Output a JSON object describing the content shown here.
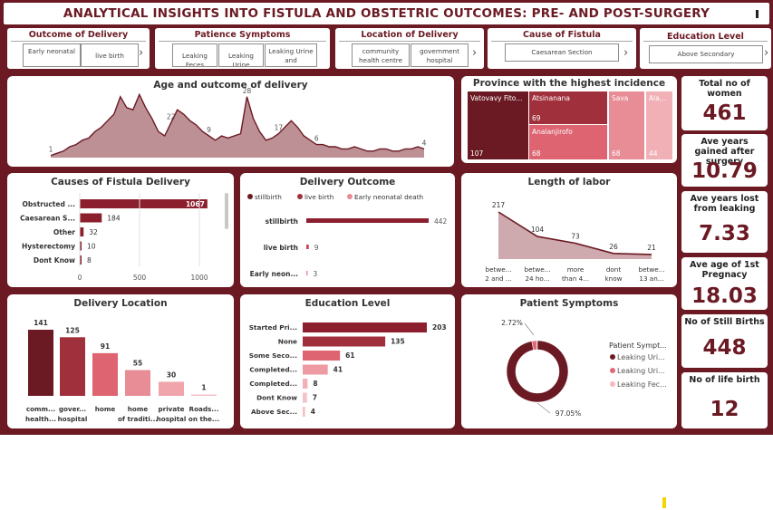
{
  "title": "ANALYTICAL INSIGHTS INTO FISTULA AND OBSTETRIC OUTCOMES: PRE- AND POST-SURGERY",
  "slicers": [
    {
      "header": "Outcome of Delivery",
      "options": [
        "Early neonatal",
        "live birth"
      ]
    },
    {
      "header": "Patience Symptoms",
      "options": [
        "Leaking Feces",
        "Leaking Urine",
        "Leaking Urine and"
      ]
    },
    {
      "header": "Location of Delivery",
      "options": [
        "community health centre",
        "government hospital"
      ]
    },
    {
      "header": "Cause of Fistula",
      "options": [
        "Caesarean Section"
      ]
    },
    {
      "header": "Education Level",
      "options": [
        "Above Secondary"
      ]
    }
  ],
  "kpis": [
    {
      "label": "Total no of women",
      "value": "461"
    },
    {
      "label": "Ave years gained after surgery",
      "value": "10.79"
    },
    {
      "label": "Ave years lost from leaking",
      "value": "7.33"
    },
    {
      "label": "Ave age of 1st Pregnacy",
      "value": "18.03"
    },
    {
      "label": "No of Still Births",
      "value": "448"
    },
    {
      "label": "No of life birth",
      "value": "12"
    }
  ],
  "chart_data": [
    {
      "id": "age",
      "type": "area",
      "title": "Age and outcome of delivery",
      "values": [
        1,
        2,
        3,
        5,
        6,
        8,
        9,
        12,
        14,
        17,
        20,
        28,
        23,
        22,
        29,
        23,
        18,
        12,
        10,
        16,
        22,
        20,
        17,
        15,
        12,
        10,
        8,
        10,
        9,
        10,
        11,
        28,
        18,
        12,
        8,
        9,
        11,
        14,
        17,
        14,
        10,
        8,
        6,
        6,
        5,
        5,
        4,
        4,
        5,
        4,
        3,
        3,
        4,
        4,
        3,
        3,
        4,
        4,
        5,
        4
      ],
      "labels": [
        {
          "i": 0,
          "text": "1"
        },
        {
          "i": 19,
          "text": "22"
        },
        {
          "i": 25,
          "text": "9"
        },
        {
          "i": 31,
          "text": "28"
        },
        {
          "i": 36,
          "text": "17"
        },
        {
          "i": 42,
          "text": "6"
        },
        {
          "i": 59,
          "text": "4"
        }
      ],
      "color": "#b27d84"
    },
    {
      "id": "province",
      "type": "treemap",
      "title": "Province with the highest incidence",
      "items": [
        {
          "name": "Vatovavy Fito...",
          "value": 107,
          "color": "#6b1a23"
        },
        {
          "name": "Atsinanana",
          "value": 69,
          "color": "#a0303c"
        },
        {
          "name": "Analanjirofo",
          "value": 68,
          "color": "#dd6470"
        },
        {
          "name": "Sava",
          "value": 68,
          "color": "#e88c96"
        },
        {
          "name": "Ala...",
          "value": 44,
          "color": "#f0b0b6"
        }
      ]
    },
    {
      "id": "causes",
      "type": "bar",
      "orientation": "horizontal",
      "title": "Causes of Fistula Delivery",
      "categories": [
        "Obstructed ...",
        "Caesarean S...",
        "Other",
        "Hysterectomy",
        "Dont Know"
      ],
      "values": [
        1067,
        184,
        32,
        10,
        8
      ],
      "xlim": [
        0,
        1000
      ],
      "ticks": [
        "0",
        "500",
        "1000"
      ],
      "color": "#8b1f2d"
    },
    {
      "id": "outcome",
      "type": "bar",
      "orientation": "horizontal",
      "title": "Delivery Outcome",
      "legend": [
        "stillbirth",
        "live birth",
        "Early neonatal death"
      ],
      "legend_colors": [
        "#6b1a23",
        "#a0303c",
        "#e88c96"
      ],
      "categories": [
        "stillbirth",
        "live birth",
        "Early neon..."
      ],
      "values": [
        442,
        9,
        3
      ],
      "colors": [
        "#8b1f2d",
        "#c54553",
        "#e88c96"
      ]
    },
    {
      "id": "labor",
      "type": "area",
      "title": "Length of labor",
      "categories": [
        "betwe... 2 and ...",
        "betwe... 24 ho...",
        "more than 4...",
        "dont know",
        "betwe... 13 an..."
      ],
      "values": [
        217,
        104,
        73,
        26,
        21
      ],
      "color": "#c9a0a5"
    },
    {
      "id": "location",
      "type": "bar",
      "title": "Delivery Location",
      "categories": [
        "comm... health...",
        "gover... hospital",
        "home",
        "home of traditi...",
        "private hospital",
        "Roads... on the..."
      ],
      "values": [
        141,
        125,
        91,
        55,
        30,
        1
      ],
      "colors": [
        "#6b1a23",
        "#a0303c",
        "#dd6470",
        "#e88c96",
        "#f0a4ac",
        "#f4c2c7"
      ]
    },
    {
      "id": "education",
      "type": "bar",
      "orientation": "horizontal",
      "title": "Education Level",
      "categories": [
        "Started Pri...",
        "None",
        "Some Seco...",
        "Completed...",
        "Completed...",
        "Dont Know",
        "Above Sec..."
      ],
      "values": [
        203,
        135,
        61,
        41,
        8,
        7,
        4
      ],
      "colors": [
        "#8b1f2d",
        "#a0303c",
        "#dd6470",
        "#ee9aa2",
        "#f2b0b6",
        "#f4c2c7",
        "#f4c2c7"
      ]
    },
    {
      "id": "symptoms",
      "type": "pie",
      "title": "Patient Symptoms",
      "legend_title": "Patient Sympt...",
      "legend": [
        "Leaking Uri...",
        "Leaking Uri...",
        "Leaking Fec..."
      ],
      "values": [
        97.05,
        2.72,
        0.23
      ],
      "value_labels": [
        "97.05%",
        "2.72%",
        "0.23%"
      ],
      "colors": [
        "#6b1a23",
        "#e06b77",
        "#f4b8be"
      ]
    }
  ]
}
